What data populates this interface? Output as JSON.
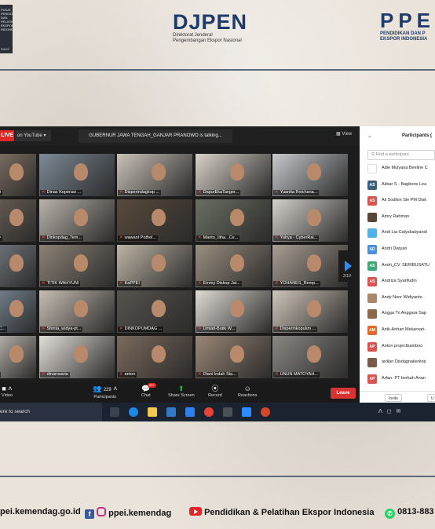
{
  "header": {
    "left_logo_text": "PUSAT PENDIDIKAN DAN PELATIHAN EKSPOR INDONESIA",
    "left_logo_sub": "RADE",
    "djpen_title": "DJPEN",
    "djpen_sub1": "Direktorat Jenderal",
    "djpen_sub2": "Pengembangan Ekspor Nasional",
    "ppei_title": "PPE",
    "ppei_sub1": "PENDIDIKAN DAN P",
    "ppei_sub2": "EKSPOR INDONESIA"
  },
  "zoom": {
    "live_label": "LIVE",
    "youtube_label": "on YouTube ▾",
    "talking": "GUBERNUR JAWA TENGAH_GANJAR PRANOWO is talking...",
    "view_label": "View",
    "page_indicator": "2/10",
    "tiles": [
      {
        "label": "...nthi",
        "bg": "#8a7a6a"
      },
      {
        "label": "Dinas Koperasi ...",
        "bg": "#7c8a96"
      },
      {
        "label": "Disperindagkop ...",
        "bg": "#c9c2b8"
      },
      {
        "label": "DapurEkaTanger...",
        "bg": "#d8d2c8"
      },
      {
        "label": "Yuanita Roichana...",
        "bg": "#c7c9cc"
      },
      {
        "label": "...OO",
        "bg": "#6f6458"
      },
      {
        "label": "Dinkopdag_Tem...",
        "bg": "#b9b3aa"
      },
      {
        "label": "wawant  Pothel...",
        "bg": "#594a3c"
      },
      {
        "label": "Manto_Iiiha...Ce...",
        "bg": "#6b6f62"
      },
      {
        "label": "Yahya - CyberRai...",
        "bg": "#d5d1cb"
      },
      {
        "label": "...ei",
        "bg": "#7a7f86"
      },
      {
        "label": "TITIK WAHYUNI",
        "bg": "#8c8275"
      },
      {
        "label": "KaPPEI",
        "bg": "#bdb4a5"
      },
      {
        "label": "Emmy Diskop Jat...",
        "bg": "#9a8f80"
      },
      {
        "label": "YOHANES_Remp...",
        "bg": "#a89e93"
      },
      {
        "label": "...ri (C...",
        "bg": "#7f8f9e"
      },
      {
        "label": "Shinta_widya-pt...",
        "bg": "#c6beb2"
      },
      {
        "label": "DINKOPUMDAG ...",
        "bg": "#57544f"
      },
      {
        "label": "Umiati-Butik W...",
        "bg": "#e0dcd6"
      },
      {
        "label": "Disperinkopukm ...",
        "bg": "#cfc6bb"
      },
      {
        "label": "...iya",
        "bg": "#cfc8bf"
      },
      {
        "label": "dinarosaria",
        "bg": "#e4dfd9"
      },
      {
        "label": "anton",
        "bg": "#7b6a5c"
      },
      {
        "label": "Diani Indah Sta...",
        "bg": "#9a8776"
      },
      {
        "label": "UNUN MATOYAH...",
        "bg": "#8b8783"
      }
    ],
    "toolbar": {
      "video": "Video",
      "participants": "Participants",
      "participants_count": "229",
      "chat": "Chat",
      "chat_badge": "99+",
      "share": "Share Screen",
      "record": "Record",
      "reactions": "Reactions",
      "leave": "Leave"
    },
    "panel": {
      "title": "Participants (",
      "search_placeholder": "Find a participant",
      "invite": "Invite",
      "mute_all": "U",
      "participants": [
        {
          "initials": "",
          "name": "Adie Mulyana Beeline C",
          "color": "#ffffff"
        },
        {
          "initials": "AS",
          "name": "Akbar S - Bagbone Lea",
          "color": "#3b5f7f"
        },
        {
          "initials": "AS",
          "name": "Ali Sodikin Sie PM Disk",
          "color": "#d9534f"
        },
        {
          "initials": "",
          "name": "Amry Rahman",
          "color": "#5a4636"
        },
        {
          "initials": "",
          "name": "Andi Lia-Calysbabyandi",
          "color": "#4fb3e3"
        },
        {
          "initials": "AD",
          "name": "Andri Dwiyan",
          "color": "#4a8fd8"
        },
        {
          "initials": "AS",
          "name": "Andri_CV. SERIBUSATU",
          "color": "#3fa67a"
        },
        {
          "initials": "AS",
          "name": "Andriza Syarifudin",
          "color": "#d9534f"
        },
        {
          "initials": "",
          "name": "Andy Noor Widiyanto",
          "color": "#a9876a"
        },
        {
          "initials": "",
          "name": "Angga Tri Anggara Sap",
          "color": "#8a6a4a"
        },
        {
          "initials": "AM",
          "name": "Anik-Anhan Mekarsari-",
          "color": "#e06a2a"
        },
        {
          "initials": "AP",
          "name": "Anton projectbamboo",
          "color": "#d9534f"
        },
        {
          "initials": "",
          "name": "ardian Disdagnakerkop",
          "color": "#7a5a4a"
        },
        {
          "initials": "AP",
          "name": "Arfan- PT berkah Anan",
          "color": "#d9534f"
        }
      ]
    }
  },
  "taskbar": {
    "search": "ere to search",
    "tray": "ᐱ ◻ ✉"
  },
  "footer": {
    "website": "pei.kemendag.go.id",
    "instagram": "ppei.kemendag",
    "youtube": "Pendidikan & Pelatihan Ekspor Indonesia",
    "whatsapp": "0813-883"
  }
}
